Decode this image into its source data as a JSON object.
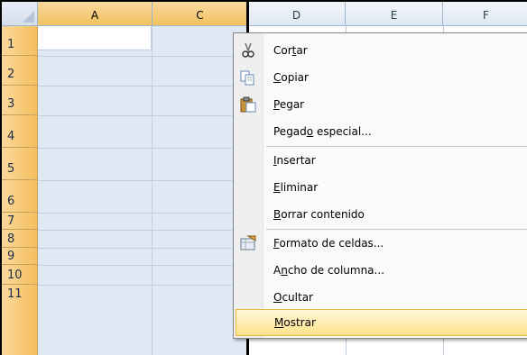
{
  "columns": [
    {
      "label": "A"
    },
    {
      "label": "C"
    },
    {
      "label": "D"
    },
    {
      "label": "E"
    },
    {
      "label": "F"
    }
  ],
  "rows": [
    "1",
    "2",
    "3",
    "4",
    "5",
    "6",
    "7",
    "8",
    "9",
    "10",
    "11"
  ],
  "context_menu": {
    "items": [
      {
        "pre": "Cor",
        "key": "t",
        "post": "ar",
        "icon": "scissors-icon"
      },
      {
        "pre": "",
        "key": "C",
        "post": "opiar",
        "icon": "copy-icon"
      },
      {
        "pre": "",
        "key": "P",
        "post": "egar",
        "icon": "paste-icon"
      },
      {
        "pre": "Pegad",
        "key": "o",
        "post": " especial...",
        "icon": ""
      },
      {
        "pre": "",
        "key": "I",
        "post": "nsertar",
        "icon": ""
      },
      {
        "pre": "",
        "key": "E",
        "post": "liminar",
        "icon": ""
      },
      {
        "pre": "",
        "key": "B",
        "post": "orrar contenido",
        "icon": ""
      },
      {
        "pre": "",
        "key": "F",
        "post": "ormato de celdas...",
        "icon": "format-cells-icon"
      },
      {
        "pre": "A",
        "key": "n",
        "post": "cho de columna...",
        "icon": ""
      },
      {
        "pre": "",
        "key": "O",
        "post": "cultar",
        "icon": ""
      },
      {
        "pre": "",
        "key": "M",
        "post": "ostrar",
        "icon": ""
      }
    ]
  }
}
